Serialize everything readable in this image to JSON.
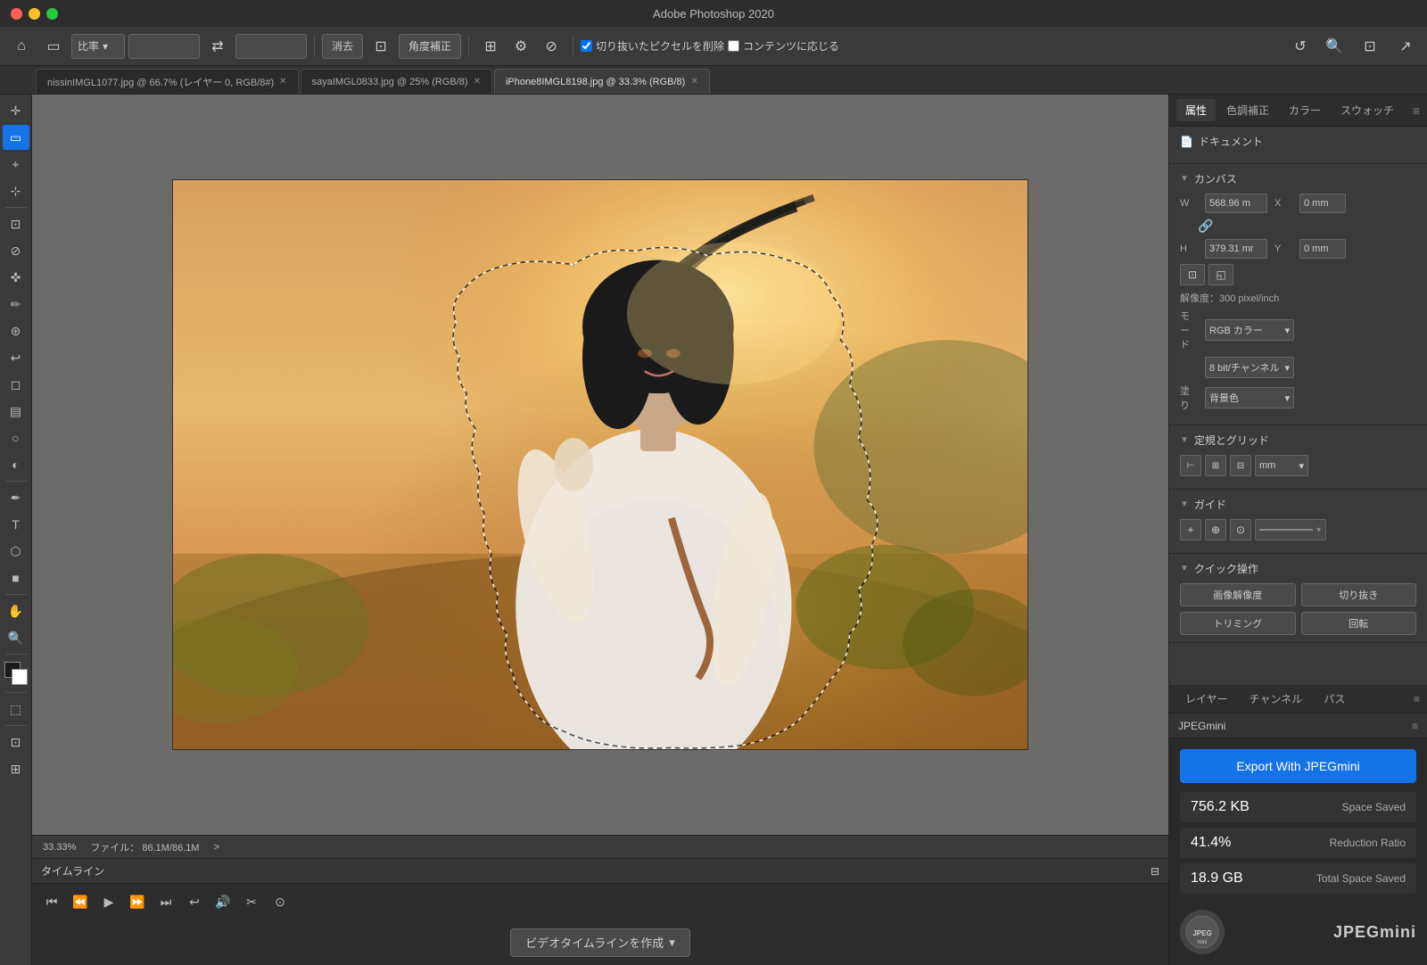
{
  "titlebar": {
    "title": "Adobe Photoshop 2020"
  },
  "menubar": {
    "zoom_label": "比率",
    "zoom_value": "",
    "erase_label": "消去",
    "angle_label": "角度補正",
    "checkbox1": "切り抜いたピクセルを削除",
    "checkbox2": "コンテンツに応じる",
    "swap_icon": "⇄"
  },
  "tabs": [
    {
      "label": "nissinIMGL1077.jpg @ 66.7% (レイヤー 0, RGB/8#)",
      "active": false,
      "closeable": true
    },
    {
      "label": "sayaIMGL0833.jpg @ 25% (RGB/8)",
      "active": false,
      "closeable": true
    },
    {
      "label": "iPhone8IMGL8198.jpg @ 33.3% (RGB/8)",
      "active": true,
      "closeable": true
    }
  ],
  "right_tabs": [
    {
      "label": "属性",
      "active": true
    },
    {
      "label": "色調補正",
      "active": false
    },
    {
      "label": "カラー",
      "active": false
    },
    {
      "label": "スウォッチ",
      "active": false
    }
  ],
  "properties": {
    "document_label": "ドキュメント",
    "canvas_label": "カンバス",
    "width_label": "W",
    "width_value": "568.96 m",
    "height_label": "H",
    "height_value": "379.31 mr",
    "x_label": "X",
    "x_value": "0 mm",
    "y_label": "Y",
    "y_value": "0 mm",
    "resolution_label": "解像度：300 pixel/inch",
    "mode_label": "モード",
    "mode_value": "RGB カラー",
    "bit_value": "8 bit/チャンネル",
    "fill_label": "塗り",
    "fill_value": "背景色",
    "rulers_label": "定規とグリッド",
    "unit_value": "mm",
    "guides_label": "ガイド",
    "quick_actions_label": "クイック操作",
    "qa_btn1": "画像解像度",
    "qa_btn2": "切り抜き",
    "qa_btn3": "トリミング",
    "qa_btn4": "回転"
  },
  "bottom_tabs": [
    {
      "label": "レイヤー",
      "active": false
    },
    {
      "label": "チャンネル",
      "active": false
    },
    {
      "label": "パス",
      "active": false
    }
  ],
  "jpegmini": {
    "panel_label": "JPEGmini",
    "export_btn": "Export With JPEGmini",
    "stat1_value": "756.2 KB",
    "stat1_label": "Space Saved",
    "stat2_value": "41.4%",
    "stat2_label": "Reduction Ratio",
    "stat3_value": "18.9 GB",
    "stat3_label": "Total Space Saved",
    "logo_text": "JPEGmini"
  },
  "status_bar": {
    "zoom": "33.33%",
    "file_label": "ファイル：",
    "file_value": "86.1M/86.1M",
    "arrow": ">"
  },
  "timeline": {
    "label": "タイムライン",
    "create_btn": "ビデオタイムラインを作成",
    "dropdown_arrow": "▾"
  }
}
